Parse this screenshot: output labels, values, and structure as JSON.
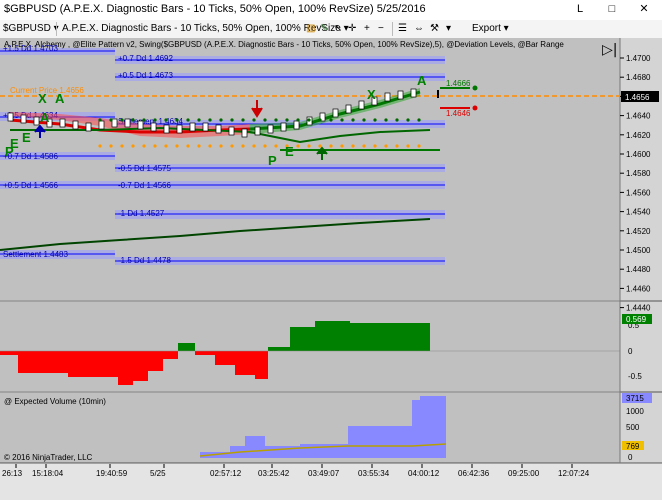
{
  "window": {
    "title": "$GBPUSD (A.P.E.X. Diagnostic Bars - 10 Ticks, 50% Open, 100% RevSize)  5/25/2016",
    "minimize_label": "L",
    "maximize_label": "□",
    "close_label": "✕"
  },
  "toolbar": {
    "instrument": "$GBPUSD",
    "bar_type": "A.P.E.X. Diagnostic Bars - 10 Ticks, 50% Open, 100% RevSize",
    "export_label": "Export"
  },
  "chart": {
    "indicator_header": "A.P.E.X. Alchemy , @Elite Pattern v2, Swing($GBPUSD (A.P.E.X. Diagnostic Bars - 10 Ticks, 50% Open, 100% RevSize),5), @Deviation Levels, @Bar Range",
    "level_labels": [
      "+1.5 Dd 1.4703",
      "+0.7 Dd 1.4692",
      "+0.5 Dd 1.4673",
      "Current Price 1.4656",
      "+0.5 Dd 1.4634",
      "Settlement 1.4634",
      "+0.7 Dd 1.4586",
      "-0.5 Dd 1.4575",
      "+0.5 Dd 1.4566",
      "-0.7 Dd 1.4566",
      "-1 Dd 1.4527",
      "Settlement 1.4483",
      "-1.5 Dd 1.4478"
    ],
    "price_ticks": [
      "1.4700",
      "1.4680",
      "1.4660",
      "1.4640",
      "1.4620",
      "1.4600",
      "1.4580",
      "1.4560",
      "1.4540",
      "1.4520",
      "1.4500",
      "1.4480",
      "1.4460",
      "1.4440"
    ],
    "current_price": "1.4656",
    "upper_tag": "1.4666",
    "lower_tag": "1.4646",
    "pattern_letters": [
      "X",
      "A",
      "A",
      "X",
      "A",
      "P",
      "E",
      "E",
      "P",
      "E"
    ],
    "osc_ticks": [
      "0.5",
      "0",
      "-0.5"
    ],
    "osc_value": "0.569",
    "volume_label": "@ Expected Volume (10min)",
    "volume_ticks": [
      "3715",
      "1000",
      "500",
      "0"
    ],
    "volume_value": "769",
    "copyright": "© 2016 NinjaTrader, LLC",
    "time_ticks": [
      "26:13",
      "15:18:04",
      "19:40:59",
      "5/25",
      "02:57:12",
      "03:25:42",
      "03:49:07",
      "03:55:34",
      "04:00:12",
      "06:42:36",
      "09:25:00",
      "12:07:24"
    ],
    "colors": {
      "bull": "#008000",
      "bear": "#ff0000",
      "volume": "#8888ff",
      "current": "#ff8c00",
      "band": "#9999ff"
    }
  },
  "icons": [
    "chart-style-icon",
    "pencil-icon",
    "cursor-icon",
    "crosshair-icon",
    "zoom-in-icon",
    "zoom-out-icon",
    "properties-icon",
    "play-icon"
  ]
}
